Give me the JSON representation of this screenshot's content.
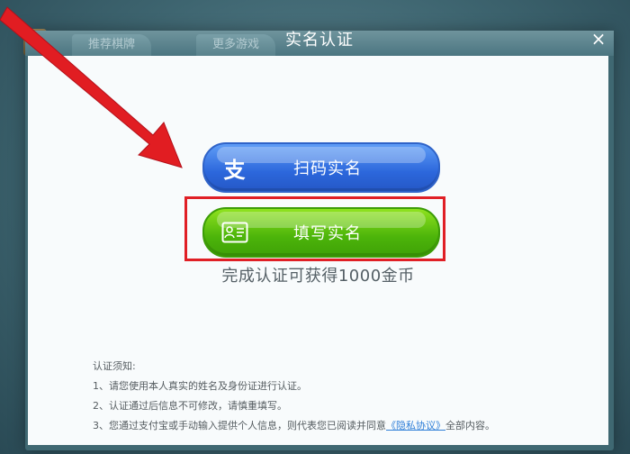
{
  "background_tabs": [
    "推荐棋牌",
    "更多游戏"
  ],
  "dialog": {
    "title": "实名认证",
    "close_symbol": "×"
  },
  "buttons": {
    "scan_label": "扫码实名",
    "fill_label": "填写实名"
  },
  "reward_text": "完成认证可获得1000金币",
  "notice": {
    "heading": "认证须知:",
    "line1": "1、请您使用本人真实的姓名及身份证进行认证。",
    "line2": "2、认证通过后信息不可修改，请慎重填写。",
    "line3_prefix": "3、您通过支付宝或手动输入提供个人信息，则代表您已阅读并同意",
    "line3_link": "《隐私协议》",
    "line3_suffix": "全部内容。"
  },
  "icons": {
    "scan": "alipay-icon",
    "fill": "id-card-icon",
    "close": "close-icon",
    "annotation": "red-arrow"
  },
  "colors": {
    "scan_button": "#2c67dc",
    "fill_button": "#4cb40a",
    "highlight": "#e01f25",
    "link": "#2f7fd8"
  }
}
